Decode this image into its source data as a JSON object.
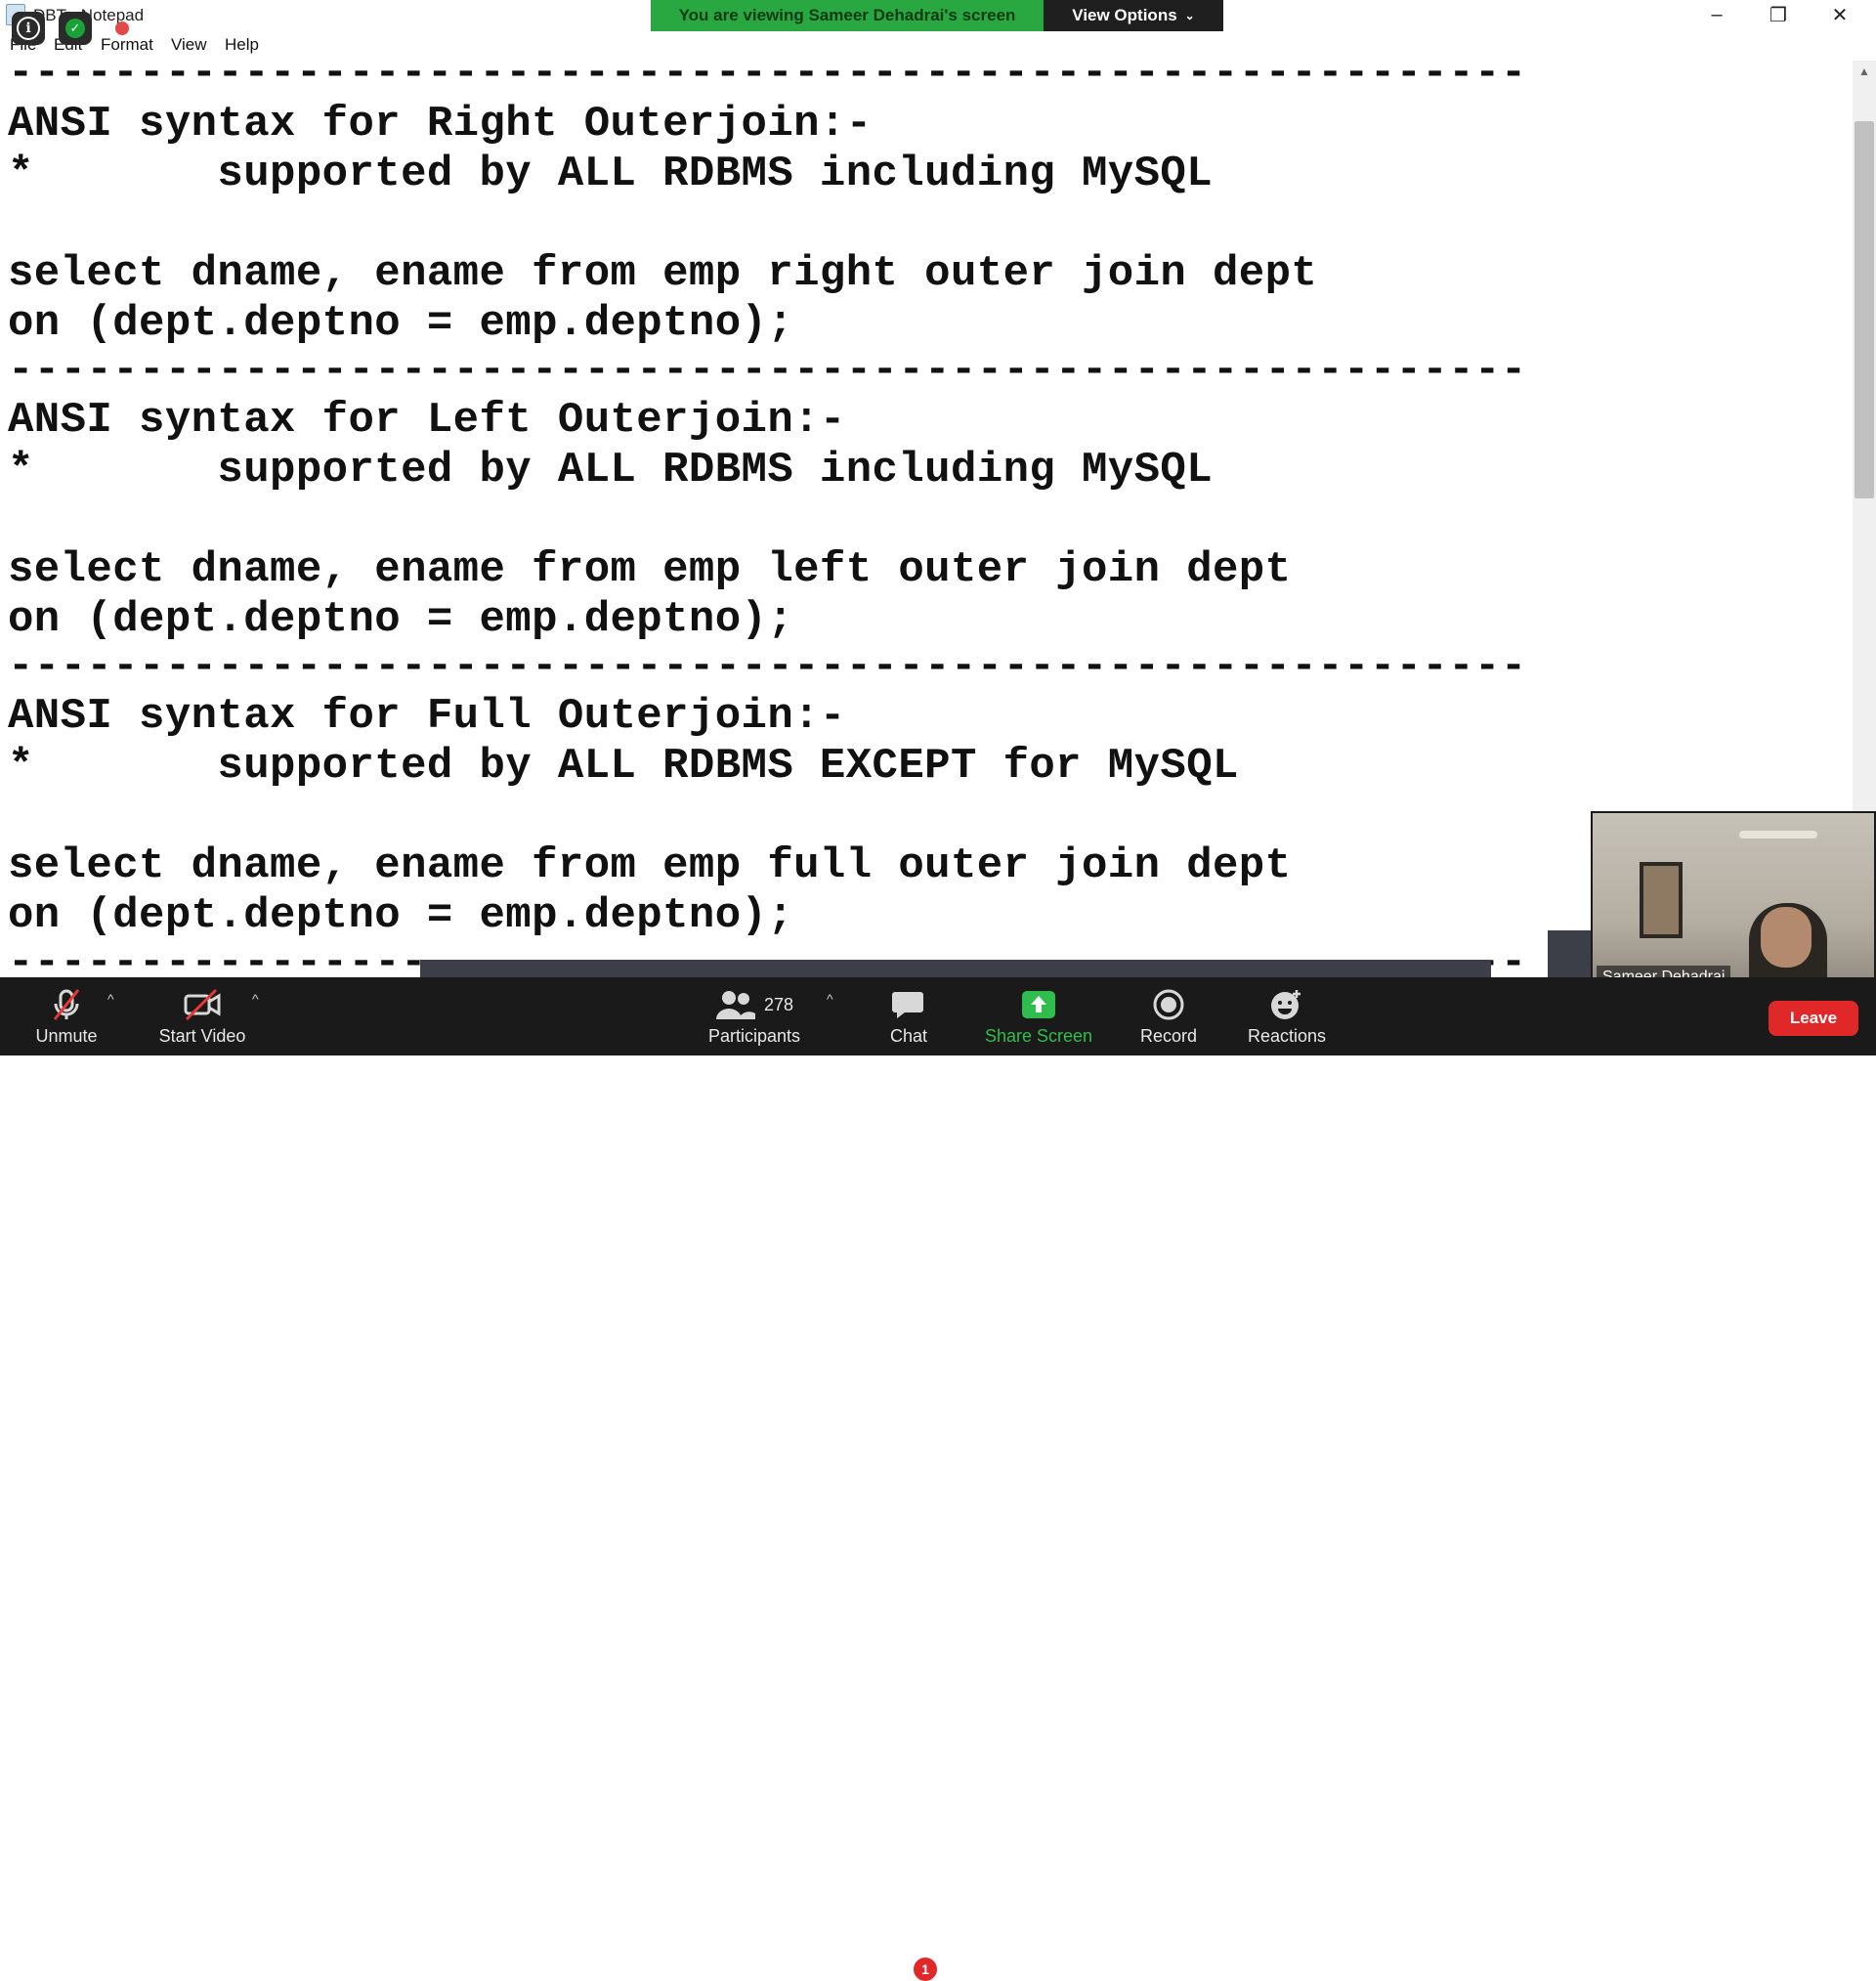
{
  "window": {
    "title": "DBT - Notepad",
    "menu": [
      "File",
      "Edit",
      "Format",
      "View",
      "Help"
    ],
    "controls": {
      "minimize": "–",
      "maximize": "❐",
      "close": "✕"
    }
  },
  "banner": {
    "text": "You are viewing Sameer Dehadrai's screen",
    "view_options": "View Options",
    "view_options_chevron": "⌄"
  },
  "overlay": {
    "info_glyph": "i",
    "shield_glyph": "✓"
  },
  "editor": {
    "lines": [
      "----------------------------------------------------------",
      "ANSI syntax for Right Outerjoin:-",
      "*       supported by ALL RDBMS including MySQL",
      "",
      "select dname, ename from emp right outer join dept",
      "on (dept.deptno = emp.deptno);",
      "----------------------------------------------------------",
      "ANSI syntax for Left Outerjoin:-",
      "*       supported by ALL RDBMS including MySQL",
      "",
      "select dname, ename from emp left outer join dept",
      "on (dept.deptno = emp.deptno);",
      "----------------------------------------------------------",
      "ANSI syntax for Full Outerjoin:-",
      "*       supported by ALL RDBMS EXCEPT for MySQL",
      "",
      "select dname, ename from emp full outer join dept",
      "on (dept.deptno = emp.deptno);",
      "----------------------------------------------------------"
    ]
  },
  "video": {
    "participant_name": "Sameer Dehadrai"
  },
  "toolbar": {
    "unmute": "Unmute",
    "start_video": "Start Video",
    "participants": "Participants",
    "participants_count": "278",
    "chat": "Chat",
    "chat_badge": "1",
    "share_screen": "Share Screen",
    "record": "Record",
    "reactions": "Reactions",
    "leave": "Leave",
    "caret": "^"
  },
  "colors": {
    "banner_green": "#29a741",
    "toolbar_bg": "#1a1a1a",
    "share_green": "#2fbe4d",
    "leave_red": "#e02828"
  }
}
